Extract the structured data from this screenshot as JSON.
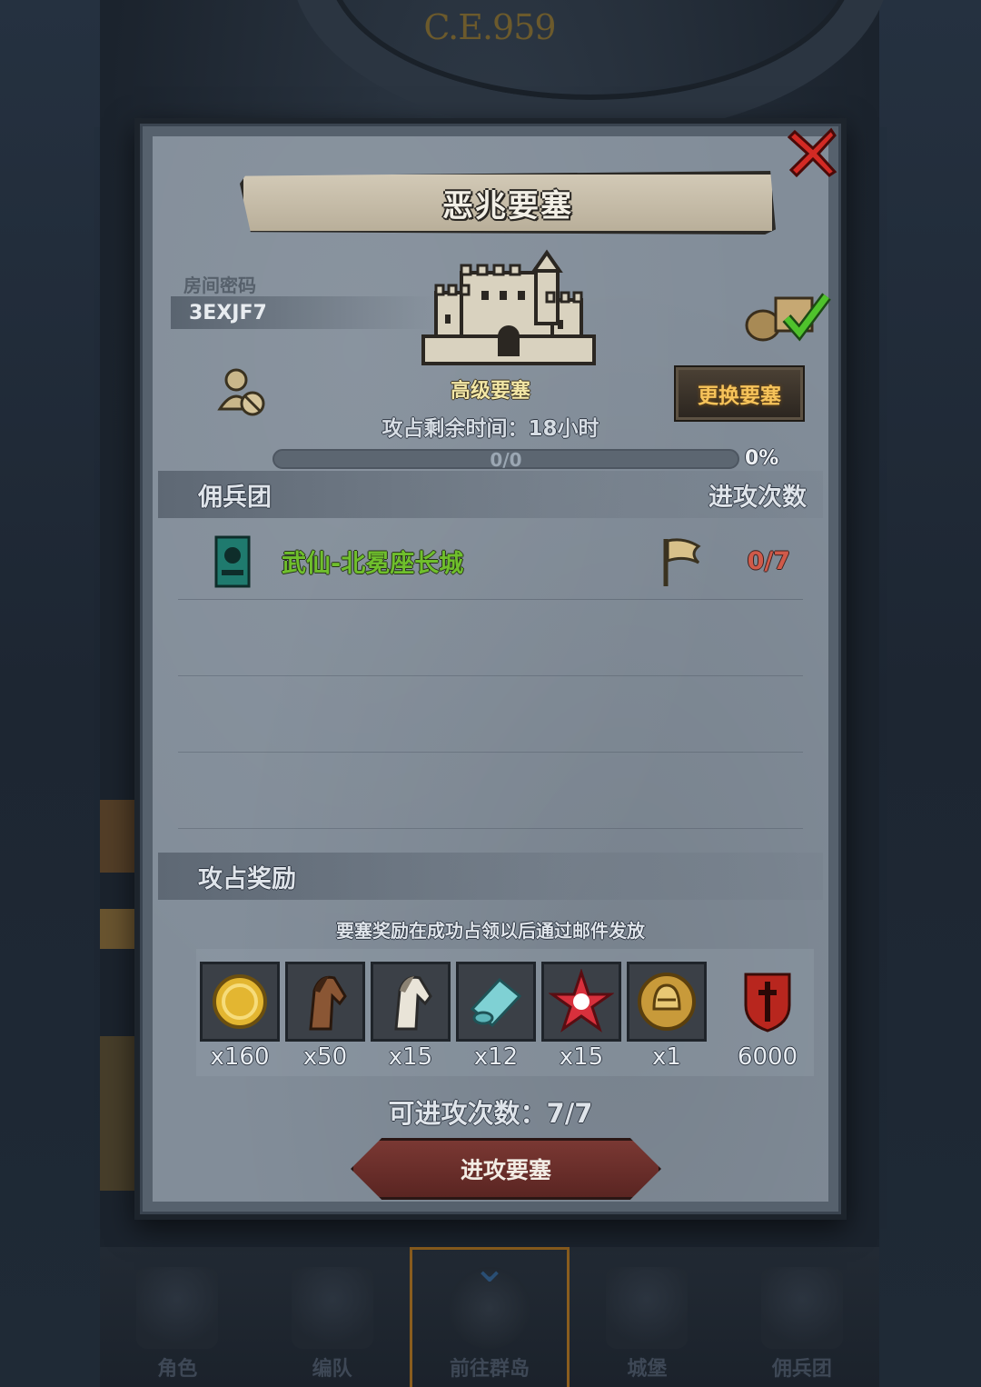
{
  "background": {
    "era": "C.E.959"
  },
  "dialog": {
    "title": "恶兆要塞",
    "room_label": "房间密码",
    "room_code": "3EXJF7",
    "fortress_type": "高级要塞",
    "remaining_time": "攻占剩余时间：18小时",
    "progress_text": "0/0",
    "progress_percent": "0%",
    "progress_value": 0,
    "change_button": "更换要塞",
    "mercenary_header": "佣兵团",
    "attack_times_header": "进攻次数",
    "mercenaries": [
      {
        "name": "武仙-北冕座长城",
        "count": "0/7"
      }
    ],
    "reward_header": "攻占奖励",
    "reward_note": "要塞奖励在成功占领以后通过邮件发放",
    "rewards": [
      {
        "icon": "gold-coin-icon",
        "qty": "x160"
      },
      {
        "icon": "brown-horse-icon",
        "qty": "x50"
      },
      {
        "icon": "white-horse-icon",
        "qty": "x15"
      },
      {
        "icon": "cloth-roll-icon",
        "qty": "x12"
      },
      {
        "icon": "red-star-gem-icon",
        "qty": "x15"
      },
      {
        "icon": "knight-helmet-coin-icon",
        "qty": "x1"
      },
      {
        "icon": "red-shield-emblem-icon",
        "qty": "6000"
      }
    ],
    "attack_count": "可进攻次数：7/7",
    "attack_button": "进攻要塞"
  },
  "bottom_nav": [
    {
      "label": "角色",
      "icon": "character-icon"
    },
    {
      "label": "编队",
      "icon": "formation-icon"
    },
    {
      "label": "前往群岛",
      "icon": "islands-icon",
      "active": true
    },
    {
      "label": "城堡",
      "icon": "castle-icon"
    },
    {
      "label": "佣兵团",
      "icon": "mercenary-icon"
    }
  ],
  "colors": {
    "merc_name": "#6fbf2c",
    "attack_count_red": "#d05a4a",
    "button_gold": "#f6c35a"
  }
}
